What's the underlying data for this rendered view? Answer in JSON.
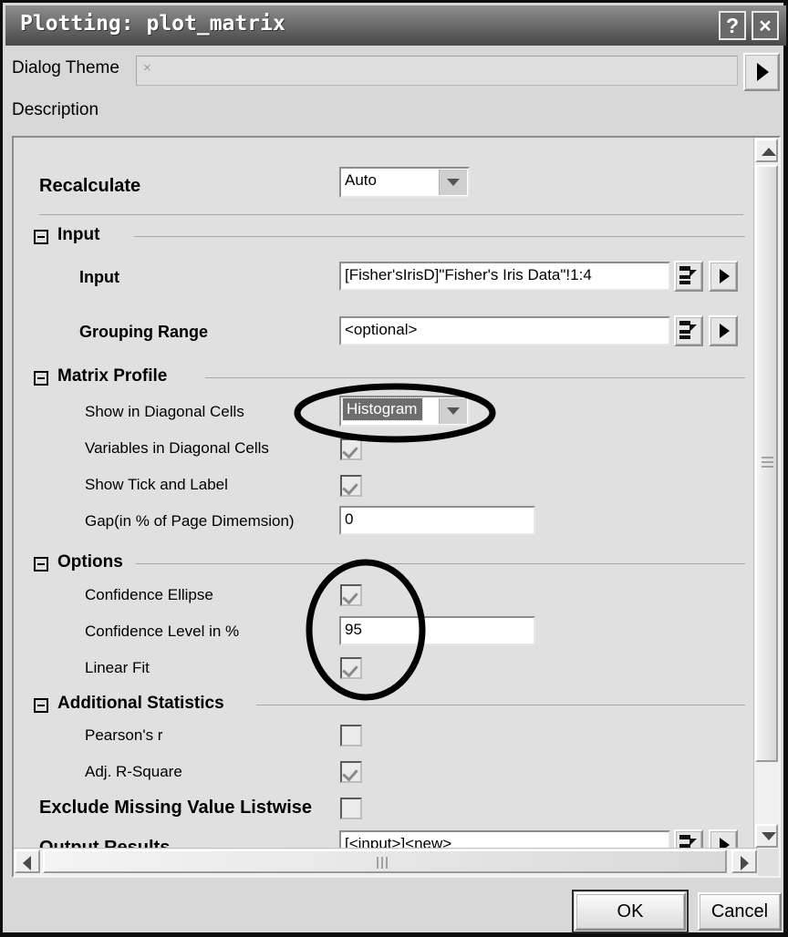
{
  "window": {
    "title": "Plotting: plot_matrix",
    "help_button": "?",
    "close_button": "×"
  },
  "theme": {
    "label": "Dialog Theme",
    "value": "×",
    "arrow_icon": "triangle-right-icon"
  },
  "description": {
    "label": "Description"
  },
  "form": {
    "recalculate": {
      "label": "Recalculate",
      "value": "Auto"
    },
    "sections": [
      {
        "title": "Input",
        "rows": [
          {
            "label": "Input",
            "value": "[Fisher'sIrisD]\"Fisher's Iris Data\"!1:4"
          },
          {
            "label": "Grouping Range",
            "value": "<optional>"
          }
        ]
      },
      {
        "title": "Matrix Profile",
        "rows": [
          {
            "label": "Show in Diagonal Cells",
            "value": "Histogram"
          },
          {
            "label": "Variables in Diagonal Cells",
            "value": "checked"
          },
          {
            "label": "Show Tick and Label",
            "value": "checked"
          },
          {
            "label": "Gap(in % of Page Dimemsion)",
            "value": "0"
          }
        ]
      },
      {
        "title": "Options",
        "rows": [
          {
            "label": "Confidence Ellipse",
            "value": "checked"
          },
          {
            "label": "Confidence Level in %",
            "value": "95"
          },
          {
            "label": "Linear Fit",
            "value": "checked"
          }
        ]
      },
      {
        "title": "Additional Statistics",
        "rows": [
          {
            "label": "Pearson's r",
            "value": "unchecked"
          },
          {
            "label": "Adj. R-Square",
            "value": "checked"
          }
        ]
      }
    ],
    "exclude_missing": {
      "label": "Exclude Missing Value Listwise",
      "value": "unchecked"
    },
    "output_results": {
      "label": "Output Results",
      "value": "[<input>]<new>"
    }
  },
  "buttons": {
    "ok": "OK",
    "cancel": "Cancel"
  },
  "annotations": {
    "ellipse_histogram": "hand-drawn-ellipse-around-histogram-dropdown",
    "ellipse_options": "hand-drawn-ellipse-around-options-controls"
  },
  "colors": {
    "window_bg": "#d8d8d8",
    "panel_bg": "#e0e0e0",
    "titlebar": "#676767",
    "annotation": "#000000",
    "selected_combo": "#6d6d6d"
  }
}
